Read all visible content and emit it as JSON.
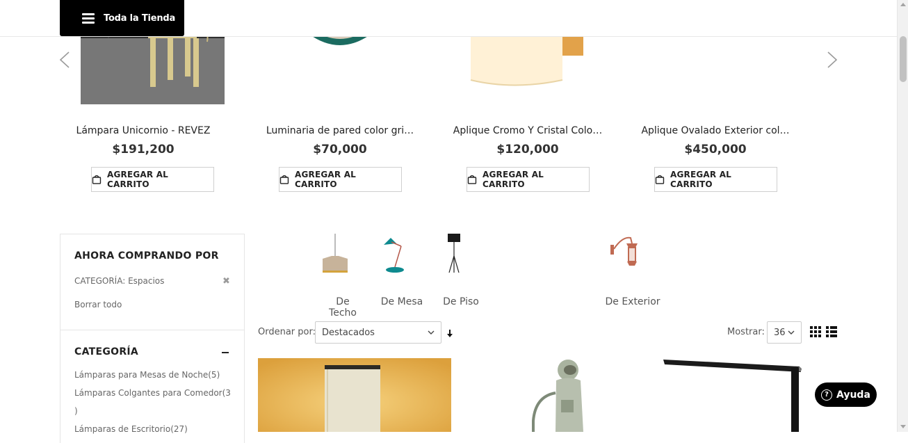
{
  "header": {
    "store_button_label": "Toda la Tienda"
  },
  "carousel": {
    "products": [
      {
        "name": "Lámpara Unicornio - REVEZ",
        "price": "$191,200",
        "button": "AGREGAR AL CARRITO"
      },
      {
        "name": "Luminaria de pared color gri…",
        "price": "$70,000",
        "button": "AGREGAR AL CARRITO"
      },
      {
        "name": "Aplique Cromo Y Cristal Colo…",
        "price": "$120,000",
        "button": "AGREGAR AL CARRITO"
      },
      {
        "name": "Aplique Ovalado Exterior col…",
        "price": "$450,000",
        "button": "AGREGAR AL CARRITO"
      }
    ]
  },
  "sidebar": {
    "shopping_by_title": "AHORA COMPRANDO POR",
    "filter_label": "CATEGORÍA:",
    "filter_value": "Espacios",
    "clear_all": "Borrar todo",
    "category_title": "CATEGORÍA",
    "categories": [
      "Lámparas para Mesas de Noche(5)",
      "Lámparas Colgantes para Comedor(3",
      ")",
      "Lámparas de Escritorio(27)"
    ]
  },
  "subcategories": [
    {
      "label": "De Techo",
      "icon": "pendant-lamp-icon"
    },
    {
      "label": "De Mesa",
      "icon": "desk-lamp-icon"
    },
    {
      "label": "De Piso",
      "icon": "floor-lamp-icon"
    },
    {
      "label": "De Exterior",
      "icon": "wall-lantern-icon"
    }
  ],
  "toolbar": {
    "sort_label": "Ordenar por:",
    "sort_value": "Destacados",
    "show_label": "Mostrar:",
    "show_value": "36"
  },
  "help": {
    "label": "Ayuda"
  }
}
